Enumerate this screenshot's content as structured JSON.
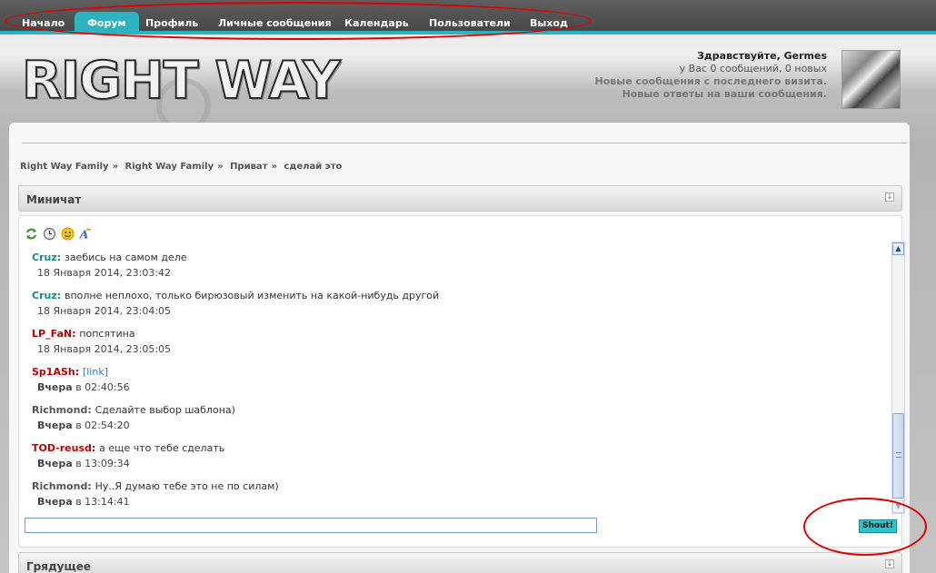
{
  "nav": {
    "items": [
      {
        "label": "Начало"
      },
      {
        "label": "Форум"
      },
      {
        "label": "Профиль"
      },
      {
        "label": "Личные сообщения"
      },
      {
        "label": "Календарь"
      },
      {
        "label": "Пользователи"
      },
      {
        "label": "Выход"
      }
    ],
    "active_index": 1
  },
  "header": {
    "logo_text": "RIGHT WAY",
    "greeting": "Здравствуйте, Germes",
    "messages_line": "у Вас 0 сообщений, 0 новых",
    "new_posts_link": "Новые сообщения с последнего визита.",
    "new_replies_link": "Новые ответы на ваши сообщения."
  },
  "breadcrumb": [
    "Right Way Family",
    "»",
    "Right Way Family",
    "»",
    "Приват",
    "»",
    "сделай это"
  ],
  "minichat": {
    "title": "Миничат",
    "collapse_icon": "collapse-arrow-icon",
    "tools": [
      "refresh-icon",
      "history-icon",
      "smiley-icon",
      "font-style-icon"
    ],
    "messages": [
      {
        "user": "Cruz",
        "user_color": "#0f8c8c",
        "text": "заебись на самом деле",
        "time": "18 Января 2014, 23:03:42"
      },
      {
        "user": "Cruz",
        "user_color": "#0f8c8c",
        "text": "вполне неплохо, только бирюзовый изменить на какой-нибудь другой",
        "time": "18 Января 2014, 23:04:05"
      },
      {
        "user": "LP_FaN",
        "user_color": "#c00000",
        "text": "попсятина",
        "time": "18 Января 2014, 23:05:05"
      },
      {
        "user": "Sp1ASh",
        "user_color": "#c00000",
        "text": "[link]",
        "day": "Вчера",
        "time": "в 02:40:56"
      },
      {
        "user": "Richmond",
        "user_color": "#555555",
        "text": "Сделайте выбор шаблона)",
        "day": "Вчера",
        "time": "в 02:54:20"
      },
      {
        "user": "TOD-reusd",
        "user_color": "#c00000",
        "text": "а еще что тебе сделать",
        "day": "Вчера",
        "time": "в 13:09:34"
      },
      {
        "user": "Richmond",
        "user_color": "#555555",
        "text": "Ну..Я думаю тебе это не по силам)",
        "day": "Вчера",
        "time": "в 13:14:41"
      }
    ],
    "input_value": "",
    "shout_label": "Shout!"
  },
  "next_block": {
    "title": "Грядущее"
  },
  "colors": {
    "accent": "#2bb3bf",
    "annotation": "#e00000"
  }
}
